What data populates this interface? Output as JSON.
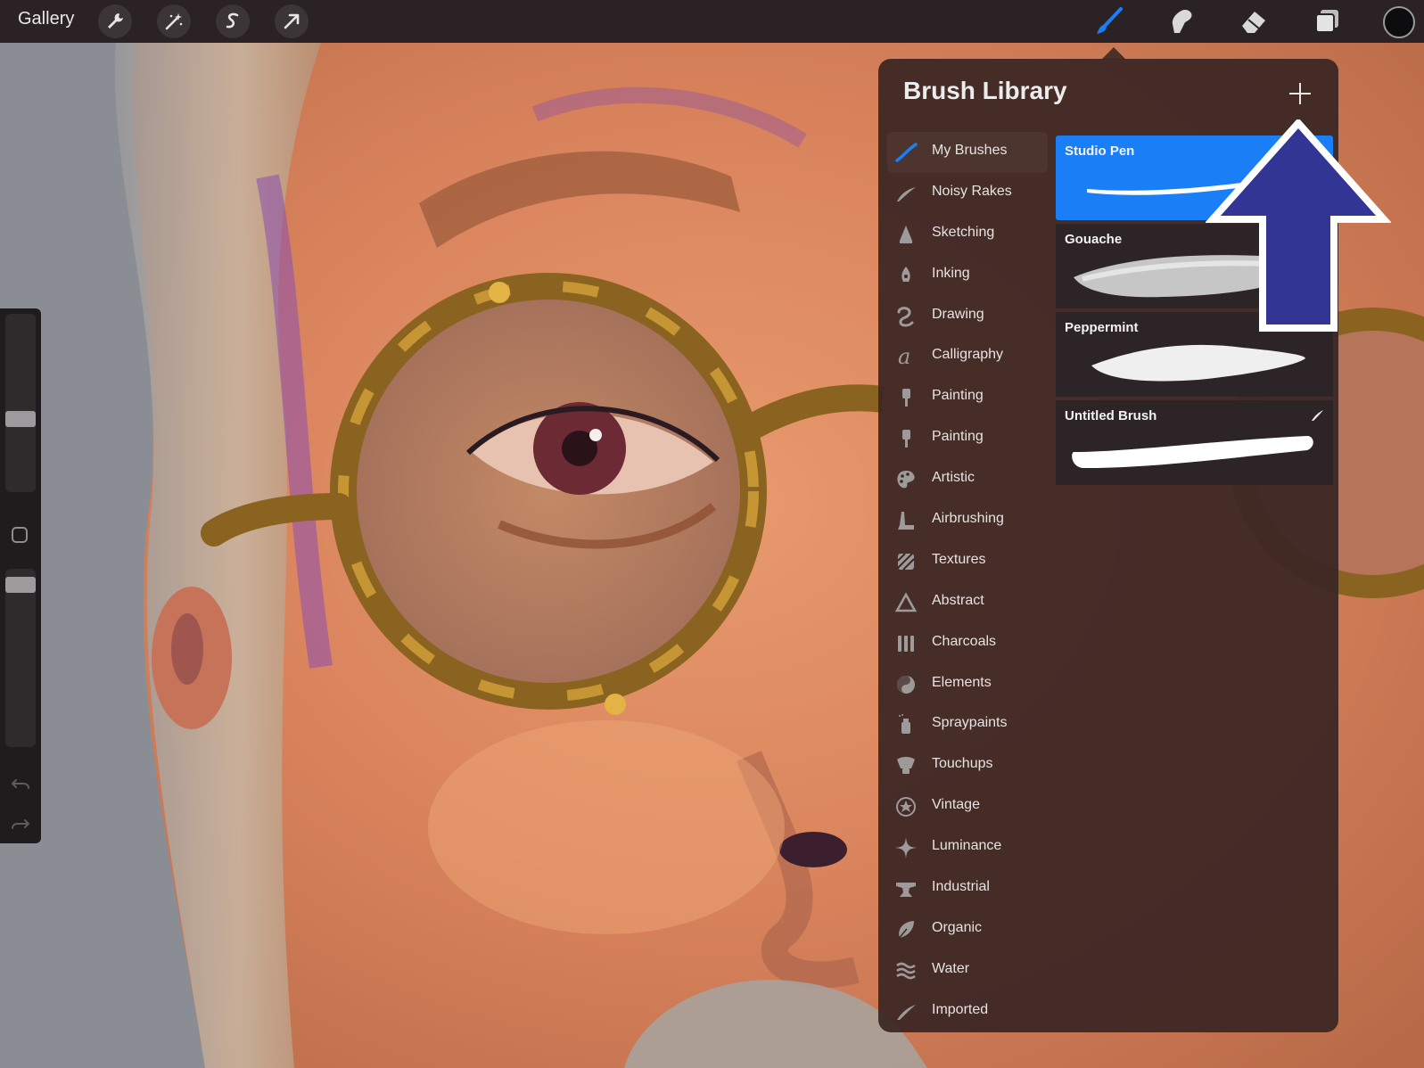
{
  "toolbar": {
    "gallery_label": "Gallery",
    "left_tools": [
      "wrench-icon",
      "magic-wand-icon",
      "selection-s-icon",
      "transform-arrow-icon"
    ],
    "right_tools": [
      "brush-icon",
      "smudge-icon",
      "eraser-icon",
      "layers-icon"
    ],
    "active_tool": "brush-icon",
    "accent_color": "#1a7ff6",
    "current_color": "#0d0d0f"
  },
  "sidebar": {
    "size_slider_level": 0.4,
    "opacity_slider_level": 0.95,
    "icons": [
      "modify-square-icon",
      "undo-icon",
      "redo-icon"
    ]
  },
  "brush_library": {
    "title": "Brush Library",
    "add_icon": "plus-icon",
    "sets": [
      {
        "label": "My Brushes",
        "icon": "brush-stroke-icon",
        "active": true
      },
      {
        "label": "Noisy Rakes",
        "icon": "feather-stroke-icon"
      },
      {
        "label": "Sketching",
        "icon": "pencil-tip-icon"
      },
      {
        "label": "Inking",
        "icon": "pen-nib-icon"
      },
      {
        "label": "Drawing",
        "icon": "squiggle-icon"
      },
      {
        "label": "Calligraphy",
        "icon": "script-a-icon"
      },
      {
        "label": "Painting",
        "icon": "paint-brush-icon"
      },
      {
        "label": "Painting",
        "icon": "paint-brush-icon"
      },
      {
        "label": "Artistic",
        "icon": "palette-icon"
      },
      {
        "label": "Airbrushing",
        "icon": "airbrush-icon"
      },
      {
        "label": "Textures",
        "icon": "texture-icon"
      },
      {
        "label": "Abstract",
        "icon": "triangle-icon"
      },
      {
        "label": "Charcoals",
        "icon": "charcoal-bars-icon"
      },
      {
        "label": "Elements",
        "icon": "yin-yang-icon"
      },
      {
        "label": "Spraypaints",
        "icon": "spray-can-icon"
      },
      {
        "label": "Touchups",
        "icon": "touchup-brush-icon"
      },
      {
        "label": "Vintage",
        "icon": "star-circle-icon"
      },
      {
        "label": "Luminance",
        "icon": "sparkle-icon"
      },
      {
        "label": "Industrial",
        "icon": "anvil-icon"
      },
      {
        "label": "Organic",
        "icon": "leaf-icon"
      },
      {
        "label": "Water",
        "icon": "waves-icon"
      },
      {
        "label": "Imported",
        "icon": "imported-stroke-icon"
      }
    ],
    "brushes": [
      {
        "name": "Studio Pen",
        "selected": true
      },
      {
        "name": "Gouache",
        "selected": false
      },
      {
        "name": "Peppermint",
        "selected": false
      },
      {
        "name": "Untitled Brush",
        "selected": false,
        "badge_icon": "custom-brush-badge-icon"
      }
    ]
  },
  "annotation": {
    "icon": "up-arrow-callout-icon",
    "color": "#323594"
  }
}
